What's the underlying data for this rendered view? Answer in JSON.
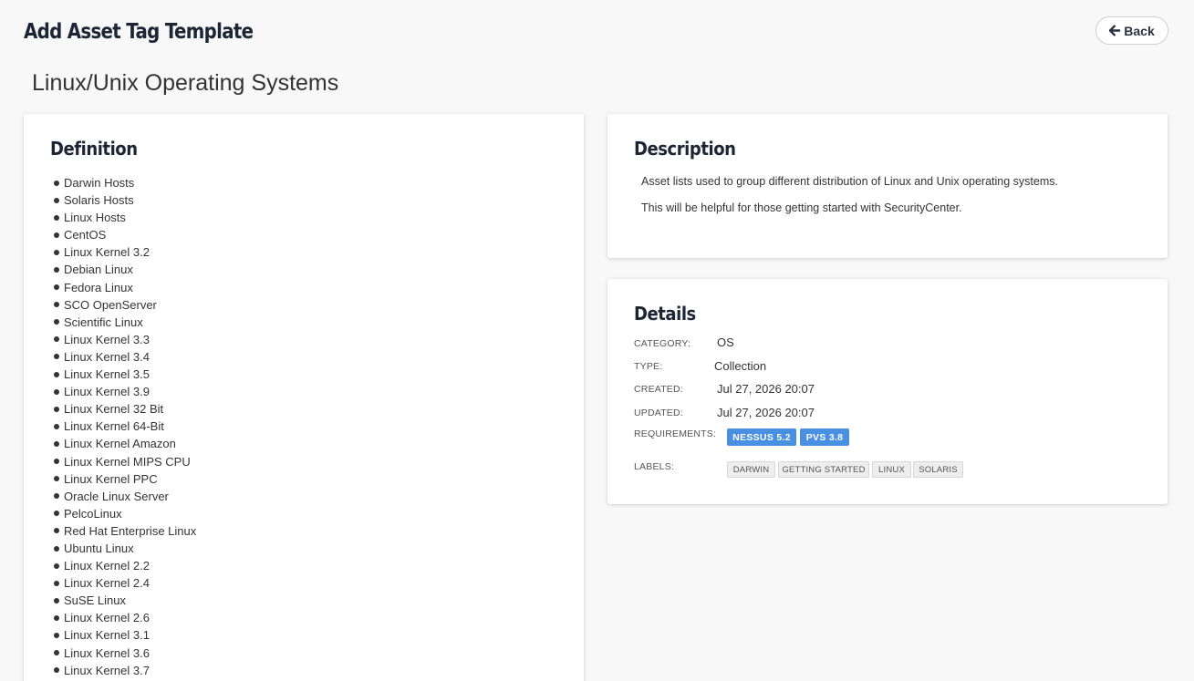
{
  "header": {
    "title": "Add Asset Tag Template",
    "back_label": "Back"
  },
  "template_name": "Linux/Unix Operating Systems",
  "definition": {
    "heading": "Definition",
    "items": [
      "Darwin Hosts",
      "Solaris Hosts",
      "Linux Hosts",
      "CentOS",
      "Linux Kernel 3.2",
      "Debian Linux",
      "Fedora Linux",
      "SCO OpenServer",
      "Scientific Linux",
      "Linux Kernel 3.3",
      "Linux Kernel 3.4",
      "Linux Kernel 3.5",
      "Linux Kernel 3.9",
      "Linux Kernel 32 Bit",
      "Linux Kernel 64-Bit",
      "Linux Kernel Amazon",
      "Linux Kernel MIPS CPU",
      "Linux Kernel PPC",
      "Oracle Linux Server",
      "PelcoLinux",
      "Red Hat Enterprise Linux",
      "Ubuntu Linux",
      "Linux Kernel 2.2",
      "Linux Kernel 2.4",
      "SuSE Linux",
      "Linux Kernel 2.6",
      "Linux Kernel 3.1",
      "Linux Kernel 3.6",
      "Linux Kernel 3.7"
    ]
  },
  "description": {
    "heading": "Description",
    "line1": "Asset lists used to group different distribution of Linux and Unix operating systems.",
    "line2": "This will be helpful for those getting started with SecurityCenter."
  },
  "details": {
    "heading": "Details",
    "category_label": "CATEGORY:",
    "category_value": "OS",
    "type_label": "TYPE:",
    "type_value": "Collection",
    "created_label": "CREATED:",
    "created_value": "Jul 27, 2026 20:07",
    "updated_label": "UPDATED:",
    "updated_value": "Jul 27, 2026 20:07",
    "requirements_label": "REQUIREMENTS:",
    "requirements": [
      "NESSUS 5.2",
      "PVS 3.8"
    ],
    "labels_label": "LABELS:",
    "labels": [
      "DARWIN",
      "GETTING STARTED",
      "LINUX",
      "SOLARIS"
    ]
  },
  "colors": {
    "badge": "#4a90e2",
    "heading": "#1b2536",
    "background": "#f8f8f8"
  }
}
